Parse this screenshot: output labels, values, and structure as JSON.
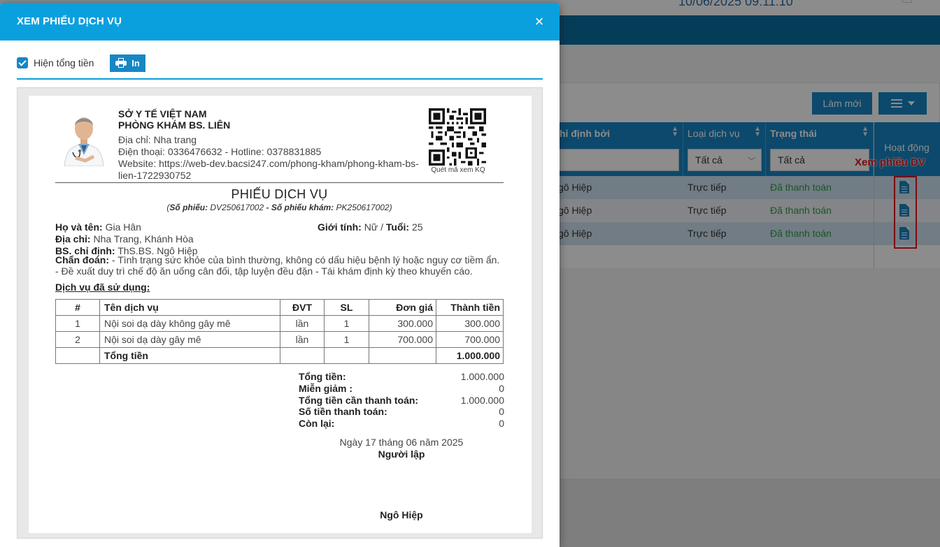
{
  "background": {
    "date_partial": "10/06/2025 09:11:10",
    "refresh_button": "Làm mới",
    "columns": {
      "assigned_by": "hỉ định bởi",
      "service_type": "Loại dịch vụ",
      "status": "Trạng thái",
      "action": "Hoạt động"
    },
    "filters": {
      "service_type": "Tất cả",
      "status": "Tất cả"
    },
    "rows": [
      {
        "assigned_by": "gô Hiệp",
        "service_type": "Trực tiếp",
        "status": "Đã thanh toán"
      },
      {
        "assigned_by": "gô Hiệp",
        "service_type": "Trực tiếp",
        "status": "Đã thanh toán"
      },
      {
        "assigned_by": "gô Hiệp",
        "service_type": "Trực tiếp",
        "status": "Đã thanh toán"
      }
    ],
    "annotation": "Xem phiếu DV",
    "colors": {
      "primary": "#1786c5",
      "status_paid": "#2f9e44",
      "annotation": "#e3141c"
    }
  },
  "modal": {
    "title": "XEM PHIẾU DỊCH VỤ",
    "close_symbol": "×",
    "show_total_label": "Hiện tổng tiền",
    "print_label": "In",
    "header_color": "#0aa0de"
  },
  "receipt": {
    "org_line1": "SỞ Y TẾ VIỆT NAM",
    "org_line2": "PHÒNG KHÁM BS. LIÊN",
    "address": "Địa chỉ: Nha trang",
    "phone": "Điện thoại: 0336476632 - Hotline: 0378831885",
    "website_1": "Website: https://web-dev.bacsi247.com/phong-kham/phong-kham-bs-",
    "website_2": "lien-1722930752",
    "qr_caption": "Quét mã xem KQ",
    "title": "PHIẾU DỊCH VỤ",
    "sub_ticket_label": "Số phiếu:",
    "sub_ticket_no": "DV250617002",
    "sub_sep": " - ",
    "sub_exam_label": "Số phiếu khám:",
    "sub_exam_no": "PK250617002",
    "patient_name_label": "Họ và tên:",
    "patient_name": "Gia Hân",
    "gender_label": "Giới tính:",
    "gender": "Nữ",
    "age_sep": " / ",
    "age_label": "Tuổi:",
    "age": "25",
    "address_label": "Địa chỉ:",
    "patient_address": "Nha Trang, Khánh Hòa",
    "doctor_label": "BS. chỉ định:",
    "doctor": "ThS.BS. Ngô Hiệp",
    "diagnosis_label": "Chẩn đoán:",
    "diagnosis": "- Tình trạng sức khỏe của bình thường, không có dấu hiệu bệnh lý hoặc nguy cơ tiềm ẩn. - Đề xuất duy trì chế độ ăn uống cân đối, tập luyện đều đặn - Tái khám định kỳ theo khuyến cáo.",
    "services_heading": "Dịch vụ đã sử dụng:",
    "table_headers": [
      "#",
      "Tên dịch vụ",
      "ĐVT",
      "SL",
      "Đơn giá",
      "Thành tiền"
    ],
    "items": [
      {
        "idx": "1",
        "name": "Nội soi dạ dày không gây mê",
        "unit": "lần",
        "qty": "1",
        "price": "300.000",
        "total": "300.000"
      },
      {
        "idx": "2",
        "name": "Nội soi dạ dày gây mê",
        "unit": "lần",
        "qty": "1",
        "price": "700.000",
        "total": "700.000"
      }
    ],
    "table_total_label": "Tổng tiền",
    "table_total_value": "1.000.000",
    "summary": [
      {
        "label": "Tổng tiền:",
        "value": "1.000.000"
      },
      {
        "label": "Miễn giảm :",
        "value": "0"
      },
      {
        "label": "Tổng tiền cần thanh toán:",
        "value": "1.000.000"
      },
      {
        "label": "Số tiền thanh toán:",
        "value": "0"
      },
      {
        "label": "Còn lại:",
        "value": "0"
      }
    ],
    "sign_date": "Ngày 17 tháng 06 năm 2025",
    "sign_role": "Người lập",
    "sign_name": "Ngô Hiệp"
  }
}
